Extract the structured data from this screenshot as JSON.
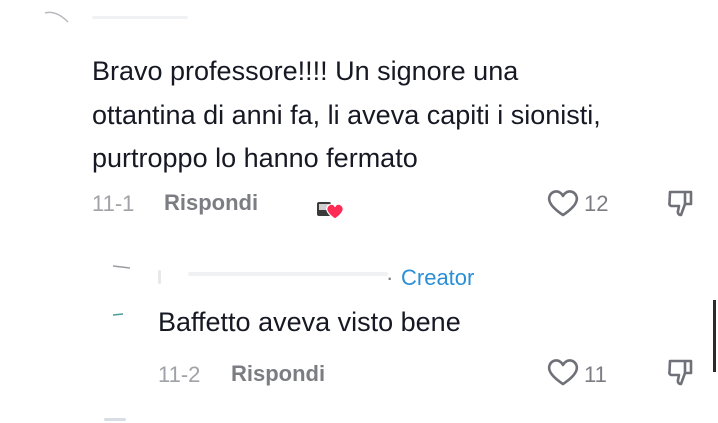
{
  "comment": {
    "text_lines": [
      "Bravo professore!!!! Un signore una",
      "ottantina di anni fa, li aveva capiti i sionisti,",
      "purtroppo lo hanno fermato"
    ],
    "date": "11-1",
    "reply_label": "Rispondi",
    "like_count": "12"
  },
  "reply": {
    "badge_separator": "·",
    "badge": "Creator",
    "text": "Baffetto aveva visto bene",
    "date": "11-2",
    "reply_label": "Rispondi",
    "like_count": "11"
  },
  "icons": {
    "like": "heart-outline-icon",
    "dislike": "thumbs-down-icon",
    "creator_liked": "creator-liked-heart-icon"
  },
  "colors": {
    "text": "#161823",
    "meta": "#7c7d83",
    "creator": "#2b8fd6",
    "liked_heart": "#fe2c55"
  }
}
